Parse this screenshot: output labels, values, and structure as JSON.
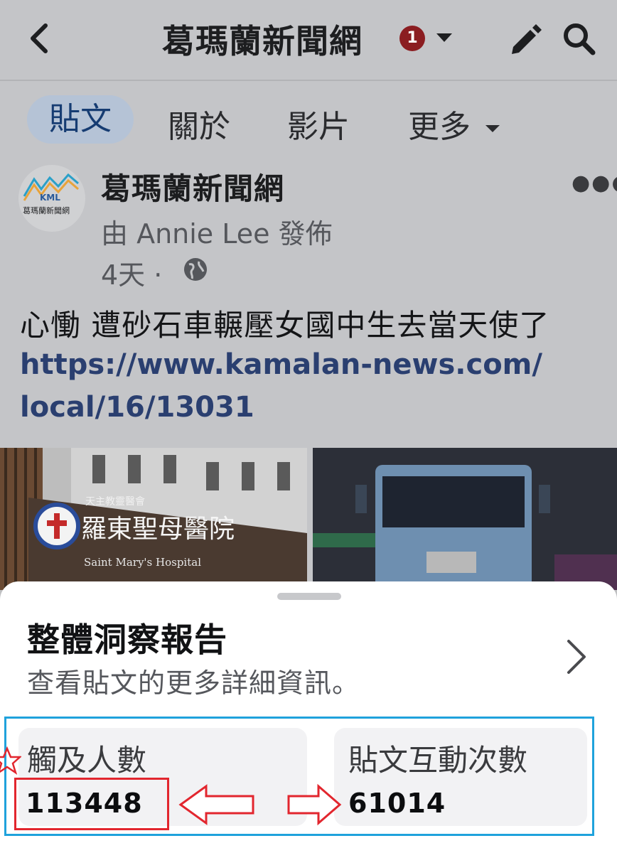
{
  "header": {
    "title": "葛瑪蘭新聞網",
    "notification_count": "1"
  },
  "tabs": [
    "貼文",
    "關於",
    "影片",
    "更多"
  ],
  "post": {
    "page_name": "葛瑪蘭新聞網",
    "logo_text": "KML",
    "logo_caption": "葛瑪蘭新聞網",
    "posted_by": "由 Annie Lee 發佈",
    "age": "4天 ·",
    "headline": "心慟 遭砂石車輾壓女國中生去當天使了",
    "link_line1": "https://www.kamalan-news.com/",
    "link_line2": "local/16/13031",
    "image_left_sign": "羅東聖母醫院",
    "image_left_sign_small": "天主教靈醫會",
    "image_left_sign_en": "Saint Mary's Hospital"
  },
  "insights": {
    "title": "整體洞察報告",
    "subtitle": "查看貼文的更多詳細資訊。",
    "reach_label": "觸及人數",
    "reach_value": "113448",
    "engagement_label": "貼文互動次數",
    "engagement_value": "61014"
  },
  "colors": {
    "accent_blue": "#163c72",
    "annotation_red": "#e2262e",
    "annotation_blue": "#1fa2dc",
    "badge": "#8b1d21"
  }
}
